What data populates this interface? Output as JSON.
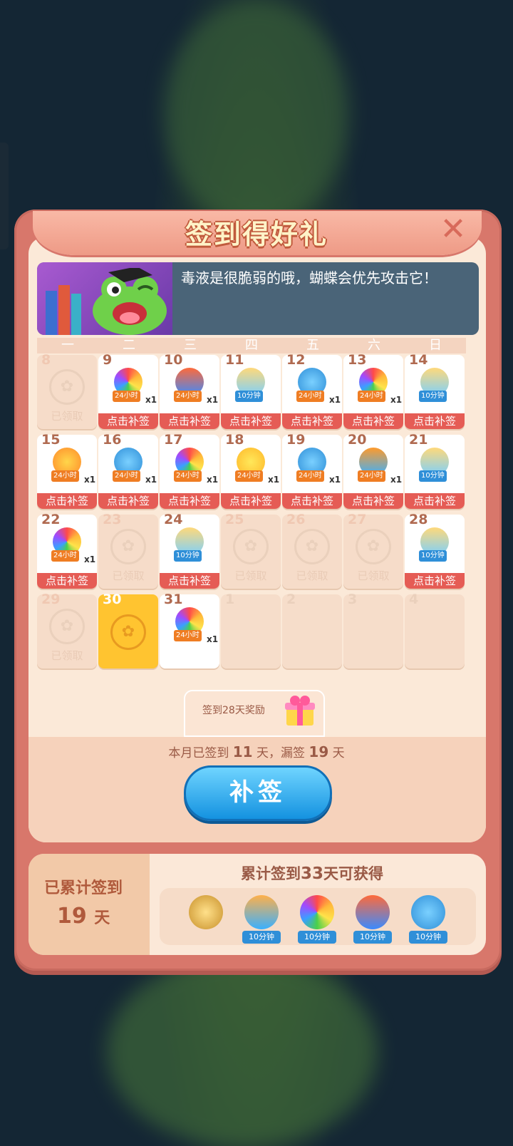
{
  "title": "签到得好礼",
  "tip": "毒液是很脆弱的哦，蝴蝶会优先攻击它！",
  "weekdays": [
    "一",
    "二",
    "三",
    "四",
    "五",
    "六",
    "日"
  ],
  "claimed_label": "已领取",
  "makeup_label": "点击补签",
  "reward_tab": "签到28天奖励",
  "stats": {
    "prefix": "本月已签到 ",
    "signed": "11",
    "mid": " 天，漏签 ",
    "missed": "19",
    "suffix": " 天"
  },
  "makeup_button": "补签",
  "cumulative": {
    "label": "已累计签到",
    "days": "19",
    "unit": "天",
    "goal_prefix": "累计签到",
    "goal_days": "33",
    "goal_suffix": "天可获得",
    "rewards": [
      {
        "name": "mystery-chest",
        "label": ""
      },
      {
        "name": "plus3-moves",
        "label": "10分钟"
      },
      {
        "name": "rainbow-peacock",
        "label": "10分钟"
      },
      {
        "name": "rockets",
        "label": "10分钟"
      },
      {
        "name": "blue-bird",
        "label": "10分钟"
      }
    ]
  },
  "days": [
    {
      "n": "8",
      "state": "claimed"
    },
    {
      "n": "9",
      "state": "makeup",
      "icon": "rainbow-peacock-icon",
      "tag": "24小时",
      "qty": "x1"
    },
    {
      "n": "10",
      "state": "makeup",
      "icon": "rockets-icon",
      "tag": "24小时",
      "qty": "x1"
    },
    {
      "n": "11",
      "state": "makeup",
      "icon": "bottle-icon",
      "tag": "10分钟",
      "qty": ""
    },
    {
      "n": "12",
      "state": "makeup",
      "icon": "blue-bird-icon",
      "tag": "24小时",
      "qty": "x1"
    },
    {
      "n": "13",
      "state": "makeup",
      "icon": "rainbow-peacock-icon",
      "tag": "24小时",
      "qty": "x1"
    },
    {
      "n": "14",
      "state": "makeup",
      "icon": "bottle-icon",
      "tag": "10分钟",
      "qty": ""
    },
    {
      "n": "15",
      "state": "makeup",
      "icon": "clock-icon",
      "tag": "24小时",
      "qty": "x1"
    },
    {
      "n": "16",
      "state": "makeup",
      "icon": "blue-bird-icon",
      "tag": "24小时",
      "qty": "x1"
    },
    {
      "n": "17",
      "state": "makeup",
      "icon": "rainbow-peacock-icon",
      "tag": "24小时",
      "qty": "x1"
    },
    {
      "n": "18",
      "state": "makeup",
      "icon": "star-icon",
      "tag": "24小时",
      "qty": "x1"
    },
    {
      "n": "19",
      "state": "makeup",
      "icon": "blue-bird-icon",
      "tag": "24小时",
      "qty": "x1"
    },
    {
      "n": "20",
      "state": "makeup",
      "icon": "plus3-icon",
      "tag": "24小时",
      "qty": "x1"
    },
    {
      "n": "21",
      "state": "makeup",
      "icon": "bottle-icon",
      "tag": "10分钟",
      "qty": ""
    },
    {
      "n": "22",
      "state": "makeup",
      "icon": "rainbow-peacock-icon",
      "tag": "24小时",
      "qty": "x1"
    },
    {
      "n": "23",
      "state": "claimed"
    },
    {
      "n": "24",
      "state": "makeup",
      "icon": "bottle-icon",
      "tag": "10分钟",
      "qty": ""
    },
    {
      "n": "25",
      "state": "claimed"
    },
    {
      "n": "26",
      "state": "claimed"
    },
    {
      "n": "27",
      "state": "claimed"
    },
    {
      "n": "28",
      "state": "makeup",
      "icon": "bottle-icon",
      "tag": "10分钟",
      "qty": ""
    },
    {
      "n": "29",
      "state": "claimed"
    },
    {
      "n": "30",
      "state": "today"
    },
    {
      "n": "31",
      "state": "future",
      "icon": "rainbow-peacock-icon",
      "tag": "24小时",
      "qty": "x1"
    },
    {
      "n": "1",
      "state": "empty"
    },
    {
      "n": "2",
      "state": "empty"
    },
    {
      "n": "3",
      "state": "empty"
    },
    {
      "n": "4",
      "state": "empty"
    }
  ],
  "colors": {
    "accent": "#e55c55",
    "button": "#1492e0",
    "today": "#ffc430"
  }
}
